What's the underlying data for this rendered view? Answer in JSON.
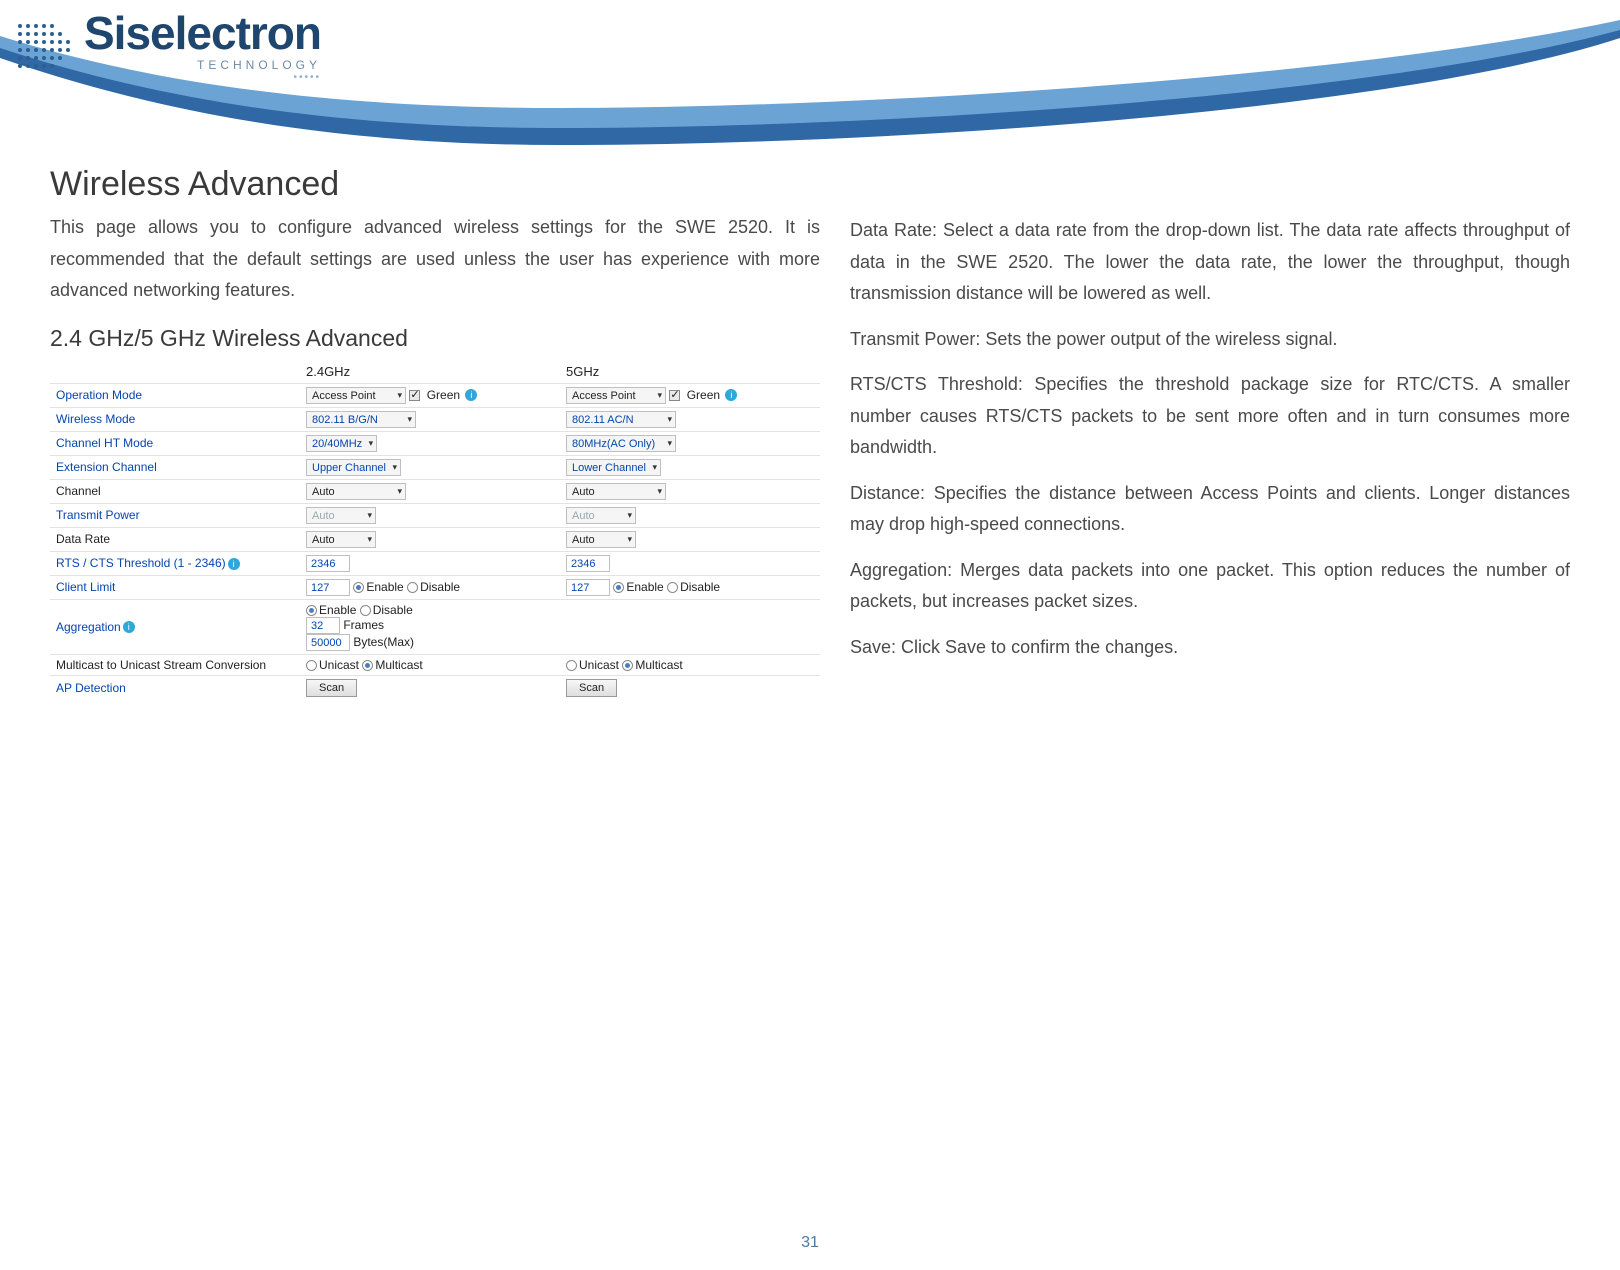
{
  "brand": {
    "name": "Siselectron",
    "sub": "TECHNOLOGY"
  },
  "hdr": {
    "title": "Wireless Advanced",
    "intro": "This  page   allows   you   to   configure  advanced   wireless settings for   the    SWE  2520.    It   is   recommended that    the default  settings are   used   unless  the   user   has   experience with  more advanced networking features.",
    "sub": "2.4  GHz/5  GHz Wireless  Advanced"
  },
  "cols": {
    "c24": "2.4GHz",
    "c5": "5GHz"
  },
  "rows": {
    "opmode": "Operation Mode",
    "wmode": "Wireless Mode",
    "htmode": "Channel HT Mode",
    "extch": "Extension Channel",
    "channel": "Channel",
    "txpower": "Transmit Power",
    "drate": "Data Rate",
    "rts": "RTS / CTS Threshold (1 - 2346)",
    "climit": "Client Limit",
    "aggr": "Aggregation",
    "mcast": "Multicast to Unicast Stream Conversion",
    "apdet": "AP Detection"
  },
  "vals24": {
    "opmode": "Access Point",
    "green": "Green",
    "wmode": "802.11 B/G/N",
    "htmode": "20/40MHz",
    "extch": "Upper Channel",
    "channel": "Auto",
    "txpower": "Auto",
    "drate": "Auto",
    "rts": "2346",
    "climit": "127",
    "climit_en": "Enable",
    "climit_dis": "Disable",
    "aggr_en": "Enable",
    "aggr_dis": "Disable",
    "aggr_frames_v": "32",
    "aggr_frames_l": "Frames",
    "aggr_bytes_v": "50000",
    "aggr_bytes_l": "Bytes(Max)",
    "mcast_uni": "Unicast",
    "mcast_multi": "Multicast",
    "scan": "Scan"
  },
  "vals5": {
    "opmode": "Access Point",
    "green": "Green",
    "wmode": "802.11 AC/N",
    "htmode": "80MHz(AC Only)",
    "extch": "Lower Channel",
    "channel": "Auto",
    "txpower": "Auto",
    "drate": "Auto",
    "rts": "2346",
    "climit": "127",
    "climit_en": "Enable",
    "climit_dis": "Disable",
    "mcast_uni": "Unicast",
    "mcast_multi": "Multicast",
    "scan": "Scan"
  },
  "right": {
    "p1": "Data  Rate: Select  a data  rate  from the  drop-down  list.  The data   rate affects  throughput of  data   in  the   SWE 2520. The  lower  the  data rate,  the  lower  the throughput, though transmission distance will be lowered  as  well.",
    "p2": "Transmit Power:   Sets  the  power  output of the  wireless signal.",
    "p3": "RTS/CTS Threshold:  Specifies   the   threshold  package  size for  RTC/CTS. A smaller  number  causes RTS/CTS packets to be sent more often and in turn consumes more  bandwidth.",
    "p4": "Distance:  Specifies     the     distance   between   Access    Points  and clients.    Longer  distances may  drop  high-speed connections.",
    "p5": "Aggregation:  Merges   data    packets into   one   packet.   This option reduces the  number  of packets, but increases packet sizes.",
    "p6": "Save: Click Save to confirm the changes."
  },
  "page_number": "31"
}
